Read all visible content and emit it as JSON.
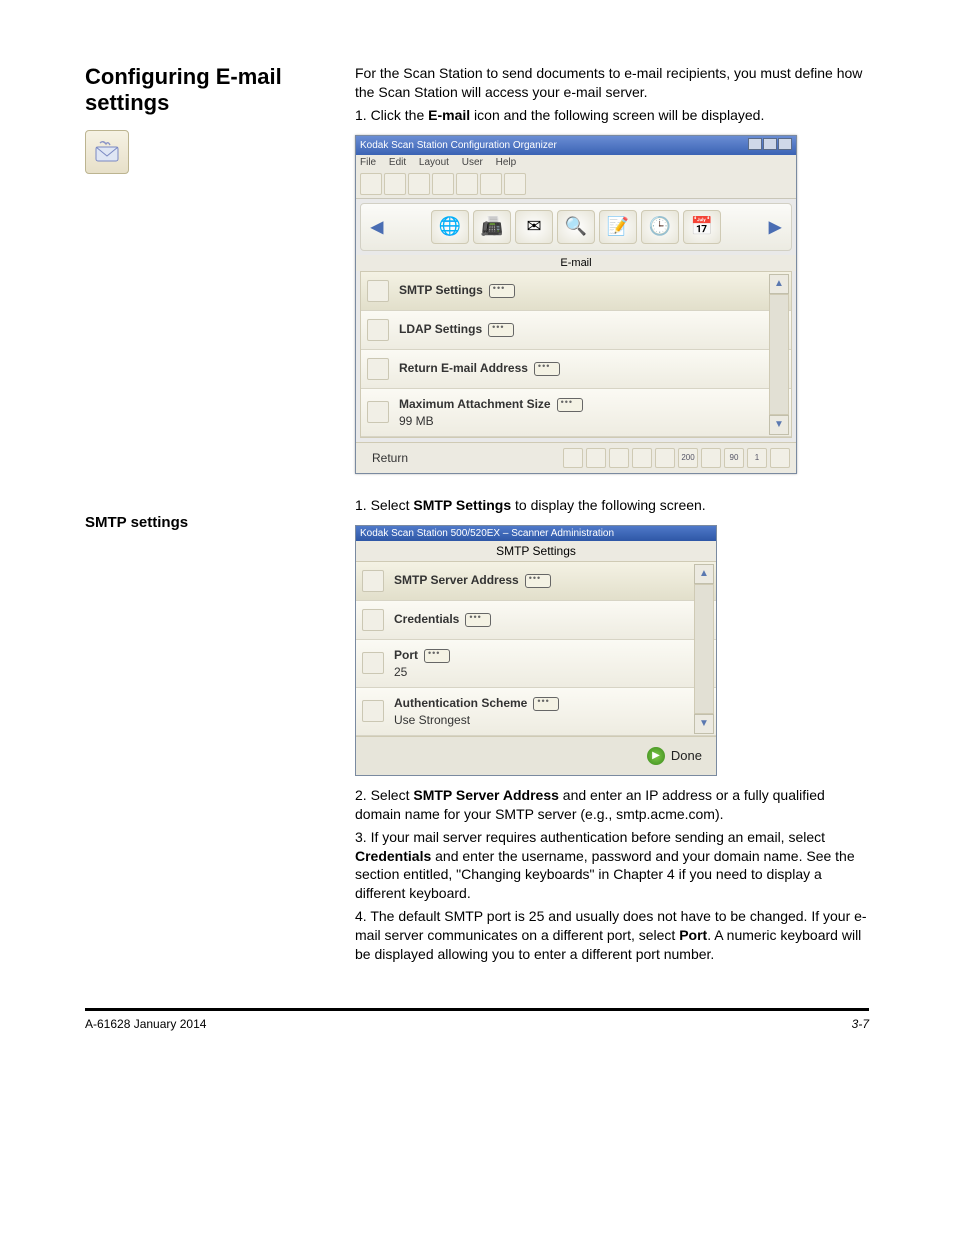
{
  "headings": {
    "configuring_email": "Configuring E-mail settings",
    "smtp_settings": "SMTP settings"
  },
  "paragraphs": {
    "intro": "For the Scan Station to send documents to e-mail recipients, you must define how the Scan Station will access your e-mail server.",
    "step1_pre": "1. Click the ",
    "step1_bold": "E-mail",
    "step1_post": " icon and the following screen will be displayed.",
    "step2_pre": "1. Select ",
    "step2_bold": "SMTP Settings",
    "step2_post": " to display the following screen.",
    "step3_pre": "2. Select ",
    "step3_bold": "SMTP Server Address",
    "step3_post": " and enter an IP address or a fully qualified domain name for your SMTP server (e.g., smtp.acme.com).",
    "step4_pre": "3. If your mail server requires authentication before sending an email, select ",
    "step4_bold": "Credentials",
    "step4_post": " and enter the username, password and your domain name. See the section entitled, \"Changing keyboards\" in Chapter 4 if you need to display a different keyboard.",
    "step5_pre": "4. The default SMTP port is 25 and usually does not have to be changed. If your e-mail server communicates on a different port, select ",
    "step5_bold": "Port",
    "step5_post": ". A numeric keyboard will be displayed allowing you to enter a different port number."
  },
  "footer": {
    "left": "A-61628  January 2014",
    "right": "3-7"
  },
  "screenshot1": {
    "title": "Kodak Scan Station Configuration Organizer",
    "menus": [
      "File",
      "Edit",
      "Layout",
      "User",
      "Help"
    ],
    "section_label": "E-mail",
    "items": [
      {
        "label": "SMTP Settings",
        "sub": ""
      },
      {
        "label": "LDAP Settings",
        "sub": ""
      },
      {
        "label": "Return E-mail Address",
        "sub": ""
      },
      {
        "label": "Maximum Attachment Size",
        "sub": "99 MB"
      }
    ],
    "return_label": "Return",
    "mini_captions": [
      "",
      "",
      "",
      "",
      "",
      "200",
      "",
      "90",
      "1",
      ""
    ]
  },
  "screenshot2": {
    "title": "Kodak Scan Station 500/520EX – Scanner Administration",
    "subhead": "SMTP Settings",
    "items": [
      {
        "label": "SMTP Server Address",
        "sub": ""
      },
      {
        "label": "Credentials",
        "sub": ""
      },
      {
        "label": "Port",
        "sub": "25"
      },
      {
        "label": "Authentication Scheme",
        "sub": "Use Strongest"
      }
    ],
    "done_label": "Done"
  }
}
